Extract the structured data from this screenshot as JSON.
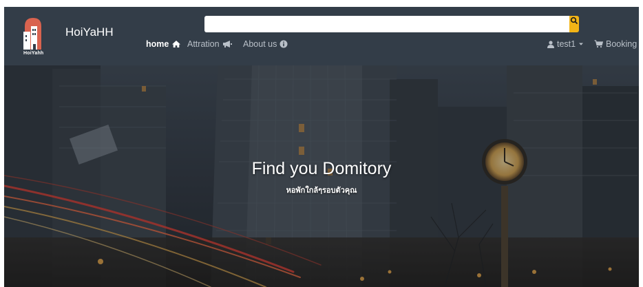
{
  "brand": {
    "logo_text": "HoiYahh",
    "name": "HoiYaHH"
  },
  "search": {
    "value": "",
    "button_icon": "search-icon"
  },
  "nav": {
    "items": [
      {
        "label": "home",
        "icon": "home-icon",
        "active": true
      },
      {
        "label": "Attration",
        "icon": "megaphone-icon",
        "active": false
      },
      {
        "label": "About us",
        "icon": "info-icon",
        "active": false
      }
    ],
    "user": {
      "label": "test1",
      "icon": "user-icon",
      "dropdown_icon": "caret-down-icon"
    },
    "booking": {
      "label": "Booking",
      "icon": "cart-icon"
    }
  },
  "hero": {
    "title": "Find you Domitory",
    "subtitle": "หอพักใกล้ๆรอบตัวคุณ"
  },
  "colors": {
    "navbar": "#333d48",
    "accent": "#f2b417",
    "logo_red": "#d9634f"
  }
}
